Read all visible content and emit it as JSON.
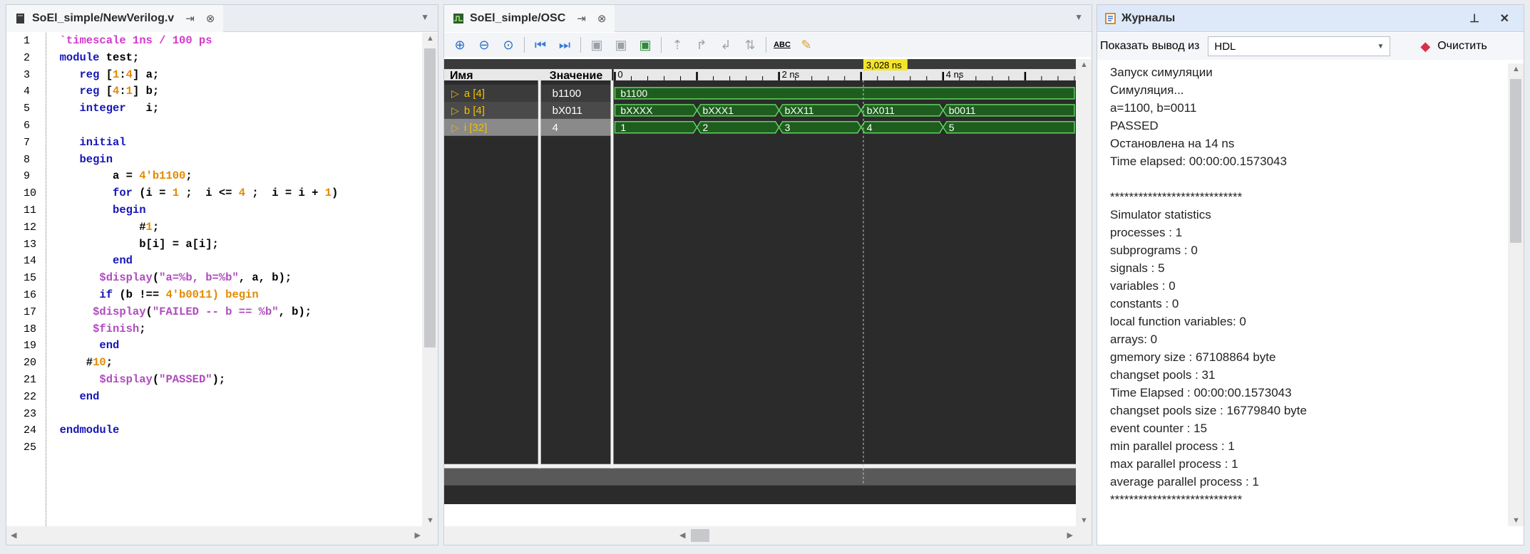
{
  "editor": {
    "tab_title": "SoEl_simple/NewVerilog.v",
    "pin_glyph": "⇥",
    "close_glyph": "⊗",
    "lines": [
      {
        "n": "1",
        "parts": [
          [
            "ts",
            "  `timescale 1ns / 100 ps"
          ]
        ]
      },
      {
        "n": "2",
        "parts": [
          [
            "kw",
            "  module "
          ],
          [
            "plain",
            "test;"
          ]
        ]
      },
      {
        "n": "3",
        "parts": [
          [
            "kw",
            "     reg "
          ],
          [
            "plain",
            "["
          ],
          [
            "num",
            "1"
          ],
          [
            "plain",
            ":"
          ],
          [
            "num",
            "4"
          ],
          [
            "plain",
            "] a;"
          ]
        ]
      },
      {
        "n": "4",
        "parts": [
          [
            "kw",
            "     reg "
          ],
          [
            "plain",
            "["
          ],
          [
            "num",
            "4"
          ],
          [
            "plain",
            ":"
          ],
          [
            "num",
            "1"
          ],
          [
            "plain",
            "] b;"
          ]
        ]
      },
      {
        "n": "5",
        "parts": [
          [
            "kw",
            "     integer   "
          ],
          [
            "plain",
            "i;"
          ]
        ]
      },
      {
        "n": "6",
        "parts": [
          [
            "plain",
            ""
          ]
        ]
      },
      {
        "n": "7",
        "parts": [
          [
            "kw",
            "     initial"
          ]
        ]
      },
      {
        "n": "8",
        "parts": [
          [
            "kw",
            "     begin"
          ]
        ]
      },
      {
        "n": "9",
        "parts": [
          [
            "plain",
            "          a = "
          ],
          [
            "num",
            "4'b1100"
          ],
          [
            "plain",
            ";"
          ]
        ]
      },
      {
        "n": "10",
        "parts": [
          [
            "kw",
            "          for "
          ],
          [
            "plain",
            "(i = "
          ],
          [
            "num",
            "1"
          ],
          [
            "plain",
            " ;  i <= "
          ],
          [
            "num",
            "4"
          ],
          [
            "plain",
            " ;  i = i + "
          ],
          [
            "num",
            "1"
          ],
          [
            "plain",
            ")"
          ]
        ]
      },
      {
        "n": "11",
        "parts": [
          [
            "kw",
            "          begin"
          ]
        ]
      },
      {
        "n": "12",
        "parts": [
          [
            "plain",
            "              #"
          ],
          [
            "num",
            "1"
          ],
          [
            "plain",
            ";"
          ]
        ]
      },
      {
        "n": "13",
        "parts": [
          [
            "plain",
            "              b[i] = a[i];"
          ]
        ]
      },
      {
        "n": "14",
        "parts": [
          [
            "kw",
            "          end"
          ]
        ]
      },
      {
        "n": "15",
        "parts": [
          [
            "sys",
            "        $display"
          ],
          [
            "plain",
            "("
          ],
          [
            "str",
            "\"a=%b, b=%b\""
          ],
          [
            "plain",
            ", a, b);"
          ]
        ]
      },
      {
        "n": "16",
        "parts": [
          [
            "kw",
            "        if "
          ],
          [
            "plain",
            "(b !== "
          ],
          [
            "num",
            "4'b0011"
          ],
          [
            "num",
            ") begin"
          ]
        ]
      },
      {
        "n": "17",
        "parts": [
          [
            "sys",
            "       $display"
          ],
          [
            "plain",
            "("
          ],
          [
            "str",
            "\"FAILED -- b == %b\""
          ],
          [
            "plain",
            ", b);"
          ]
        ]
      },
      {
        "n": "18",
        "parts": [
          [
            "sys",
            "       $finish"
          ],
          [
            "plain",
            ";"
          ]
        ]
      },
      {
        "n": "19",
        "parts": [
          [
            "kw",
            "        end"
          ]
        ]
      },
      {
        "n": "20",
        "parts": [
          [
            "plain",
            "      #"
          ],
          [
            "num",
            "10"
          ],
          [
            "plain",
            ";"
          ]
        ]
      },
      {
        "n": "21",
        "parts": [
          [
            "sys",
            "        $display"
          ],
          [
            "plain",
            "("
          ],
          [
            "str",
            "\"PASSED\""
          ],
          [
            "plain",
            ");"
          ]
        ]
      },
      {
        "n": "22",
        "parts": [
          [
            "kw",
            "     end"
          ]
        ]
      },
      {
        "n": "23",
        "parts": [
          [
            "plain",
            ""
          ]
        ]
      },
      {
        "n": "24",
        "parts": [
          [
            "kw",
            "  endmodule"
          ]
        ]
      },
      {
        "n": "25",
        "parts": [
          [
            "plain",
            ""
          ]
        ]
      }
    ]
  },
  "osc": {
    "tab_title": "SoEl_simple/OSC",
    "pin_glyph": "⇥",
    "close_glyph": "⊗",
    "header_name": "Имя",
    "header_value": "Значение",
    "cursor_label": "3,028 ns",
    "cursor_time": 3.028,
    "time_max": 5.6,
    "ticks": [
      {
        "t": 0,
        "label": "0"
      },
      {
        "t": 2,
        "label": "2 ns"
      },
      {
        "t": 4,
        "label": "4 ns"
      }
    ],
    "signals": [
      {
        "name": "a [4]",
        "value": "b1100",
        "segments": [
          {
            "from": 0,
            "to": 5.6,
            "label": "b1100"
          }
        ]
      },
      {
        "name": "b [4]",
        "value": "bX011",
        "segments": [
          {
            "from": 0,
            "to": 1,
            "label": "bXXXX"
          },
          {
            "from": 1,
            "to": 2,
            "label": "bXXX1"
          },
          {
            "from": 2,
            "to": 3,
            "label": "bXX11"
          },
          {
            "from": 3,
            "to": 4,
            "label": "bX011"
          },
          {
            "from": 4,
            "to": 5.6,
            "label": "b0011"
          }
        ]
      },
      {
        "name": "i [32]",
        "value": "4",
        "segments": [
          {
            "from": 0,
            "to": 1,
            "label": "1"
          },
          {
            "from": 1,
            "to": 2,
            "label": "2"
          },
          {
            "from": 2,
            "to": 3,
            "label": "3"
          },
          {
            "from": 3,
            "to": 4,
            "label": "4"
          },
          {
            "from": 4,
            "to": 5.6,
            "label": "5"
          }
        ]
      }
    ]
  },
  "log": {
    "title": "Журналы",
    "pin_glyph": "⊥",
    "close_glyph": "✕",
    "output_label": "Показать вывод из",
    "output_value": "HDL",
    "clear_label": "Очистить",
    "lines": [
      "Запуск симуляции",
      "Симуляция...",
      "a=1100, b=0011",
      "PASSED",
      "Остановлена на 14 ns",
      "Time elapsed: 00:00:00.1573043",
      "",
      "****************************",
      "Simulator statistics",
      "processes : 1",
      "subprograms : 0",
      "signals : 5",
      "variables : 0",
      "constants : 0",
      "local function variables: 0",
      "arrays: 0",
      "gmemory size : 67108864 byte",
      "changset pools : 31",
      "Time Elapsed : 00:00:00.1573043",
      "changset pools size : 16779840 byte",
      "event counter : 15",
      "min parallel process : 1",
      "max parallel process : 1",
      "average parallel process : 1",
      "****************************"
    ]
  }
}
